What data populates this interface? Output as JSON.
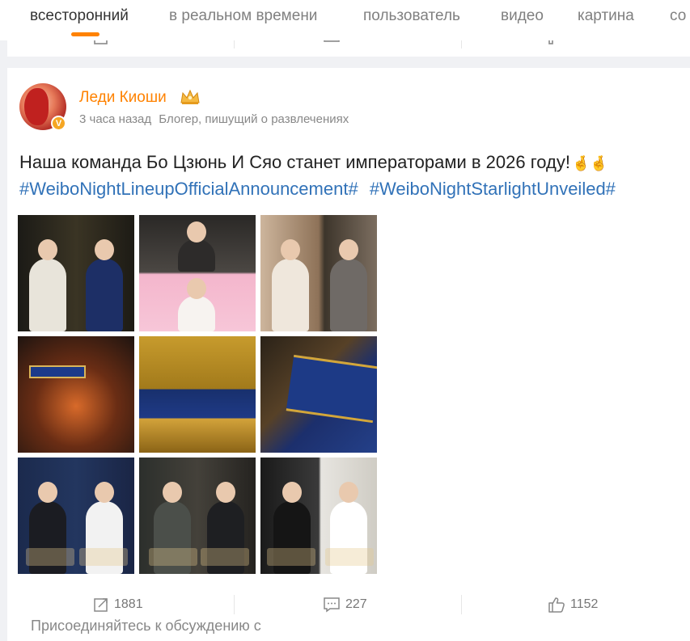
{
  "tabs": [
    {
      "label": "всесторонний",
      "active": true
    },
    {
      "label": "в реальном времени",
      "active": false
    },
    {
      "label": "пользователь",
      "active": false
    },
    {
      "label": "видео",
      "active": false
    },
    {
      "label": "картина",
      "active": false
    },
    {
      "label": "со",
      "active": false
    }
  ],
  "accent_color": "#ff8200",
  "link_color": "#3172b8",
  "post": {
    "author": "Леди Киоши",
    "author_badge_icon": "crown-icon",
    "verified_icon": "v-badge-icon",
    "verified_label": "V",
    "time": "3 часа назад",
    "author_description": "Блогер, пишущий о развлечениях",
    "text": "Наша команда Бо Цзюнь И Сяо станет императорами в 2026 году!",
    "emoji": "🤞🤞",
    "hashtags": [
      "#WeiboNightLineupOfficialAnnouncement#",
      "#WeiboNightStarlightUnveiled#"
    ],
    "images": [
      {
        "alt": "photo-1"
      },
      {
        "alt": "photo-2"
      },
      {
        "alt": "photo-3"
      },
      {
        "alt": "photo-4"
      },
      {
        "alt": "photo-5"
      },
      {
        "alt": "photo-6"
      },
      {
        "alt": "photo-7"
      },
      {
        "alt": "photo-8"
      },
      {
        "alt": "photo-9"
      }
    ],
    "stats": {
      "reposts": "1881",
      "comments": "227",
      "likes": "1152"
    },
    "join_text": "Присоединяйтесь к обсуждению с"
  }
}
